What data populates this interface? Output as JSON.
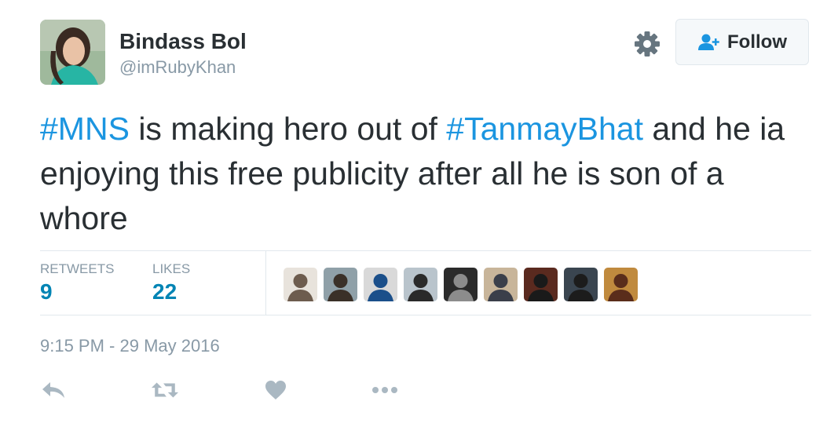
{
  "author": {
    "name": "Bindass Bol",
    "handle": "@imRubyKhan"
  },
  "follow_button": {
    "label": "Follow",
    "icon": "add-user-icon"
  },
  "settings": {
    "icon": "gear-icon"
  },
  "tweet": {
    "segments": [
      {
        "text": "#MNS",
        "hashtag": true
      },
      {
        "text": " is making hero out of ",
        "hashtag": false
      },
      {
        "text": "#TanmayBhat",
        "hashtag": true
      },
      {
        "text": " and he ia enjoying this free publicity after all he is son of a whore",
        "hashtag": false
      }
    ]
  },
  "stats": {
    "retweets_label": "RETWEETS",
    "retweets_value": "9",
    "likes_label": "LIKES",
    "likes_value": "22"
  },
  "liker_avatars": [
    {
      "icon": "avatar-1",
      "colors": [
        "#e8e3dc",
        "#6d5c4e"
      ]
    },
    {
      "icon": "avatar-2",
      "colors": [
        "#8fa0a8",
        "#3a3028"
      ]
    },
    {
      "icon": "avatar-3",
      "colors": [
        "#d9d9d9",
        "#1b4f8a"
      ]
    },
    {
      "icon": "avatar-4",
      "colors": [
        "#b9c4cc",
        "#2a2a2a"
      ]
    },
    {
      "icon": "avatar-5",
      "colors": [
        "#2b2b2b",
        "#8c8c8c"
      ]
    },
    {
      "icon": "avatar-6",
      "colors": [
        "#c8b59a",
        "#3b3f4a"
      ]
    },
    {
      "icon": "avatar-7",
      "colors": [
        "#5a2a1f",
        "#1a1a1a"
      ]
    },
    {
      "icon": "avatar-8",
      "colors": [
        "#3a4550",
        "#1c1c1c"
      ]
    },
    {
      "icon": "avatar-9",
      "colors": [
        "#c08a3e",
        "#5a2d1b"
      ]
    }
  ],
  "timestamp": "9:15 PM - 29 May 2016",
  "actions": [
    {
      "icon": "reply-icon"
    },
    {
      "icon": "retweet-icon"
    },
    {
      "icon": "heart-icon"
    },
    {
      "icon": "more-icon"
    }
  ],
  "colors": {
    "hashtag": "#1b95e0",
    "stat_value": "#0084b4",
    "muted": "#8899a6",
    "text": "#292f33",
    "icon": "#aab8c2"
  }
}
